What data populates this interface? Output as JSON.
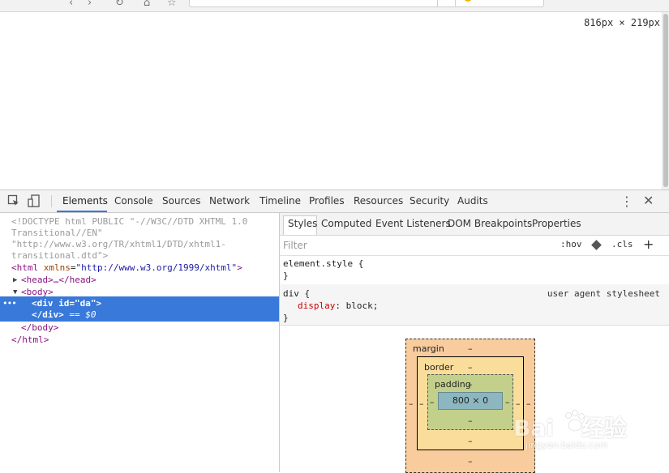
{
  "viewport": {
    "size_label": "816px × 219px"
  },
  "devtools": {
    "tabs": [
      "Elements",
      "Console",
      "Sources",
      "Network",
      "Timeline",
      "Profiles",
      "Resources",
      "Security",
      "Audits"
    ],
    "active_tab": "Elements",
    "more_glyph": "⋮",
    "close_glyph": "✕"
  },
  "dom": {
    "doctype_1": "<!DOCTYPE html PUBLIC \"-//W3C//DTD XHTML 1.0",
    "doctype_2": "Transitional//EN\"",
    "doctype_3": "\"http://www.w3.org/TR/xhtml1/DTD/xhtml1-",
    "doctype_4": "transitional.dtd\">",
    "html_open_tag": "<html",
    "html_attr": "xmlns",
    "html_attr_value": "\"http://www.w3.org/1999/xhtml\"",
    "html_close_bracket": ">",
    "head_line": "<head>…</head>",
    "body_open": "<body>",
    "div_open_tag": "<div",
    "div_attr": "id",
    "div_attr_value": "\"da\"",
    "div_close_bracket": ">",
    "div_close": "</div>",
    "selected_marker": "== $0",
    "body_close": "</body>",
    "html_close": "</html>",
    "ellipsis": "•••"
  },
  "styles": {
    "subtabs": [
      "Styles",
      "Computed",
      "Event Listeners",
      "DOM Breakpoints",
      "Properties"
    ],
    "active_subtab": "Styles",
    "filter_placeholder": "Filter",
    "hov_label": ":hov",
    "cls_label": ".cls",
    "plus_label": "+",
    "element_style_open": "element.style {",
    "element_style_close": "}",
    "ua_selector": "div {",
    "ua_source": "user agent stylesheet",
    "ua_property": "display",
    "ua_value": "block;",
    "ua_close": "}"
  },
  "box_model": {
    "margin_label": "margin",
    "border_label": "border",
    "padding_label": "padding",
    "content_size": "800 × 0",
    "dash": "–"
  },
  "watermark": {
    "logo": "Bai",
    "logo_cn": "经验",
    "url": "jingyan.baidu.com"
  },
  "colors": {
    "selection": "#3879d9",
    "tag": "#881280",
    "attr": "#994500",
    "value": "#1a1aa6",
    "margin": "#f9cc9d",
    "border": "#fbdd9b",
    "padding": "#c3d08b",
    "content": "#8cb6c0"
  }
}
